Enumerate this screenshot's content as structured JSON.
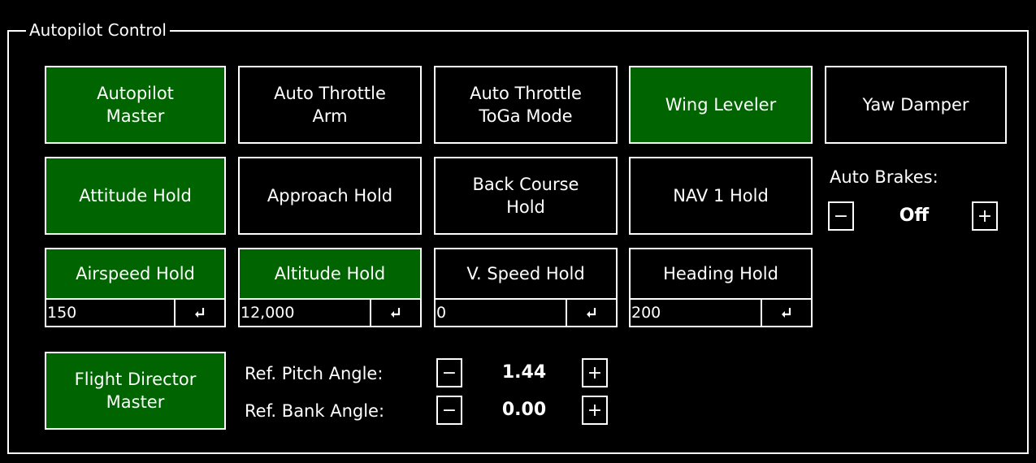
{
  "panel": {
    "title": "Autopilot Control"
  },
  "row1": {
    "autopilot_master": "Autopilot\nMaster",
    "auto_throttle_arm": "Auto Throttle\nArm",
    "auto_throttle_toga": "Auto Throttle\nToGa Mode",
    "wing_leveler": "Wing Leveler",
    "yaw_damper": "Yaw Damper"
  },
  "row2": {
    "attitude_hold": "Attitude Hold",
    "approach_hold": "Approach Hold",
    "back_course_hold": "Back Course\nHold",
    "nav1_hold": "NAV 1 Hold"
  },
  "auto_brakes": {
    "label": "Auto Brakes:",
    "value": "Off",
    "minus": "−",
    "plus": "+"
  },
  "holds": {
    "airspeed": {
      "label": "Airspeed Hold",
      "value": "150"
    },
    "altitude": {
      "label": "Altitude Hold",
      "value": "12,000"
    },
    "vspeed": {
      "label": "V. Speed Hold",
      "value": "0"
    },
    "heading": {
      "label": "Heading Hold",
      "value": "200"
    }
  },
  "flight_director": {
    "label": "Flight Director\nMaster"
  },
  "ref_pitch": {
    "label": "Ref. Pitch Angle:",
    "value": "1.44",
    "minus": "−",
    "plus": "+"
  },
  "ref_bank": {
    "label": "Ref. Bank Angle:",
    "value": "0.00",
    "minus": "−",
    "plus": "+"
  },
  "states": {
    "active_color": "#006400",
    "autopilot_master_on": true,
    "wing_leveler_on": true,
    "attitude_hold_on": true,
    "airspeed_hold_on": true,
    "altitude_hold_on": true,
    "flight_director_on": true
  },
  "icons": {
    "enter": "enter-return-icon"
  }
}
